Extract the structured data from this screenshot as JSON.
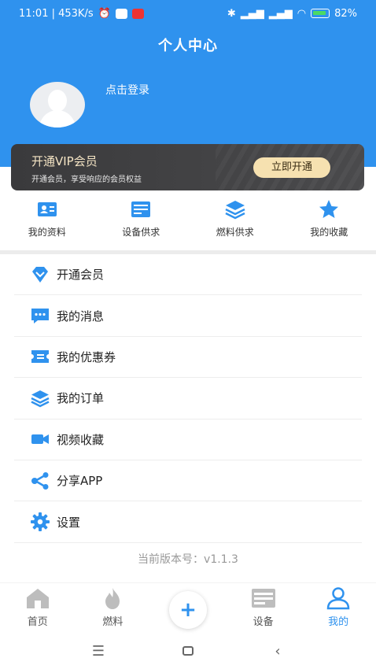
{
  "status_bar": {
    "time_speed": "11:01 | 453K/s",
    "battery": "82%"
  },
  "header": {
    "title": "个人中心",
    "login_text": "点击登录",
    "brand_color": "#2f92ee"
  },
  "vip": {
    "title": "开通VIP会员",
    "subtitle": "开通会员，享受响应的会员权益",
    "button": "立即开通"
  },
  "quick_actions": [
    {
      "label": "我的资料",
      "icon": "profile-card-icon"
    },
    {
      "label": "设备供求",
      "icon": "device-icon"
    },
    {
      "label": "燃料供求",
      "icon": "layers-icon"
    },
    {
      "label": "我的收藏",
      "icon": "star-icon"
    }
  ],
  "menu": [
    {
      "label": "开通会员",
      "icon": "diamond-icon"
    },
    {
      "label": "我的消息",
      "icon": "message-icon"
    },
    {
      "label": "我的优惠券",
      "icon": "coupon-icon"
    },
    {
      "label": "我的订单",
      "icon": "layers-icon"
    },
    {
      "label": "视频收藏",
      "icon": "video-icon"
    },
    {
      "label": "分享APP",
      "icon": "share-icon"
    },
    {
      "label": "设置",
      "icon": "gear-icon"
    }
  ],
  "version": "当前版本号：v1.1.3",
  "tabbar": {
    "items": [
      {
        "label": "首页",
        "icon": "home-icon"
      },
      {
        "label": "燃料",
        "icon": "flame-icon"
      },
      {
        "label": "",
        "icon": "plus-icon"
      },
      {
        "label": "设备",
        "icon": "device-icon"
      },
      {
        "label": "我的",
        "icon": "user-icon",
        "active": true
      }
    ]
  }
}
